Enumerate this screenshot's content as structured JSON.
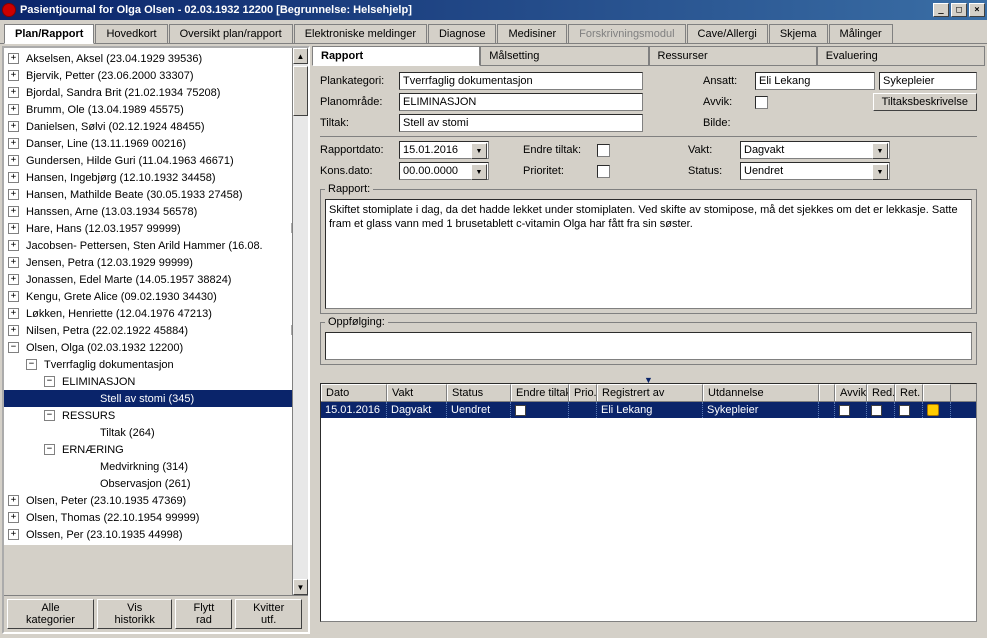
{
  "window": {
    "title": "Pasientjournal for Olga Olsen - 02.03.1932 12200   [Begrunnelse: Helsehjelp]"
  },
  "mainTabs": [
    {
      "label": "Plan/Rapport",
      "active": true
    },
    {
      "label": "Hovedkort"
    },
    {
      "label": "Oversikt plan/rapport"
    },
    {
      "label": "Elektroniske meldinger"
    },
    {
      "label": "Diagnose"
    },
    {
      "label": "Medisiner"
    },
    {
      "label": "Forskrivningsmodul",
      "disabled": true
    },
    {
      "label": "Cave/Allergi"
    },
    {
      "label": "Skjema"
    },
    {
      "label": "Målinger"
    }
  ],
  "tree": [
    {
      "label": "Akselsen, Aksel (23.04.1929 39536)",
      "exp": "+",
      "indent": 0
    },
    {
      "label": "Bjervik, Petter (23.06.2000 33307)",
      "exp": "+",
      "indent": 0
    },
    {
      "label": "Bjordal, Sandra Brit (21.02.1934 75208)",
      "exp": "+",
      "indent": 0
    },
    {
      "label": "Brumm, Ole (13.04.1989 45575)",
      "exp": "+",
      "indent": 0
    },
    {
      "label": "Danielsen, Sølvi (02.12.1924 48455)",
      "exp": "+",
      "indent": 0
    },
    {
      "label": "Danser, Line (13.11.1969 00216)",
      "exp": "+",
      "indent": 0
    },
    {
      "label": "Gundersen, Hilde Guri (11.04.1963 46671)",
      "exp": "+",
      "indent": 0
    },
    {
      "label": "Hansen, Ingebjørg (12.10.1932 34458)",
      "exp": "+",
      "indent": 0
    },
    {
      "label": "Hansen, Mathilde Beate (30.05.1933 27458)",
      "exp": "+",
      "indent": 0
    },
    {
      "label": "Hanssen, Arne (13.03.1934 56578)",
      "exp": "+",
      "indent": 0
    },
    {
      "label": "Hare, Hans (12.03.1957 99999)",
      "exp": "+",
      "indent": 0,
      "flag": true
    },
    {
      "label": "Jacobsen- Pettersen, Sten Arild Hammer (16.08.",
      "exp": "+",
      "indent": 0
    },
    {
      "label": "Jensen, Petra (12.03.1929 99999)",
      "exp": "+",
      "indent": 0
    },
    {
      "label": "Jonassen, Edel Marte (14.05.1957 38824)",
      "exp": "+",
      "indent": 0
    },
    {
      "label": "Kengu, Grete Alice (09.02.1930 34430)",
      "exp": "+",
      "indent": 0
    },
    {
      "label": "Løkken, Henriette (12.04.1976 47213)",
      "exp": "+",
      "indent": 0
    },
    {
      "label": "Nilsen, Petra (22.02.1922 45884)",
      "exp": "+",
      "indent": 0,
      "flag": true
    },
    {
      "label": "Olsen, Olga (02.03.1932 12200)",
      "exp": "-",
      "indent": 0
    },
    {
      "label": "Tverrfaglig dokumentasjon",
      "exp": "-",
      "indent": 1
    },
    {
      "label": "ELIMINASJON",
      "exp": "-",
      "indent": 2
    },
    {
      "label": "Stell av stomi (345)",
      "exp": "",
      "indent": 3,
      "selected": true
    },
    {
      "label": "RESSURS",
      "exp": "-",
      "indent": 2
    },
    {
      "label": "Tiltak (264)",
      "exp": "",
      "indent": 3
    },
    {
      "label": "ERNÆRING",
      "exp": "-",
      "indent": 2
    },
    {
      "label": "Medvirkning (314)",
      "exp": "",
      "indent": 3
    },
    {
      "label": "Observasjon (261)",
      "exp": "",
      "indent": 3
    },
    {
      "label": "Olsen, Peter (23.10.1935 47369)",
      "exp": "+",
      "indent": 0
    },
    {
      "label": "Olsen, Thomas (22.10.1954 99999)",
      "exp": "+",
      "indent": 0
    },
    {
      "label": "Olssen, Per (23.10.1935 44998)",
      "exp": "+",
      "indent": 0
    }
  ],
  "leftButtons": {
    "alle": "Alle kategorier",
    "vis": "Vis historikk",
    "flytt": "Flytt rad",
    "kvitter": "Kvitter utf."
  },
  "subTabs": [
    {
      "label": "Rapport",
      "active": true
    },
    {
      "label": "Målsetting"
    },
    {
      "label": "Ressurser"
    },
    {
      "label": "Evaluering"
    }
  ],
  "form": {
    "plankategori_label": "Plankategori:",
    "plankategori": "Tverrfaglig dokumentasjon",
    "planomrade_label": "Planområde:",
    "planomrade": "ELIMINASJON",
    "tiltak_label": "Tiltak:",
    "tiltak": "Stell av stomi",
    "ansatt_label": "Ansatt:",
    "ansatt": "Eli Lekang",
    "stilling": "Sykepleier",
    "avvik_label": "Avvik:",
    "bilde_label": "Bilde:",
    "tiltaksbeskrivelse": "Tiltaksbeskrivelse",
    "rapportdato_label": "Rapportdato:",
    "rapportdato": "15.01.2016",
    "konsdato_label": "Kons.dato:",
    "konsdato": "00.00.0000",
    "endre_label": "Endre tiltak:",
    "prioritet_label": "Prioritet:",
    "vakt_label": "Vakt:",
    "vakt": "Dagvakt",
    "status_label": "Status:",
    "status": "Uendret",
    "rapport_legend": "Rapport:",
    "rapport_text": "Skiftet stomiplate i dag, da det hadde lekket under stomiplaten. Ved skifte av stomipose, må det sjekkes om det er lekkasje. Satte fram et glass vann med 1 brusetablett c-vitamin Olga har fått fra sin søster.",
    "oppf_legend": "Oppfølging:"
  },
  "grid": {
    "headers": {
      "dato": "Dato",
      "vakt": "Vakt",
      "status": "Status",
      "endre": "Endre tiltak",
      "prio": "Prio.",
      "reg": "Registrert av",
      "utd": "Utdannelse",
      "blank": "",
      "avvik": "Avvik",
      "red": "Red.",
      "ret": "Ret.",
      "icon": ""
    },
    "row": {
      "dato": "15.01.2016",
      "vakt": "Dagvakt",
      "status": "Uendret",
      "reg": "Eli Lekang",
      "utd": "Sykepleier"
    }
  }
}
